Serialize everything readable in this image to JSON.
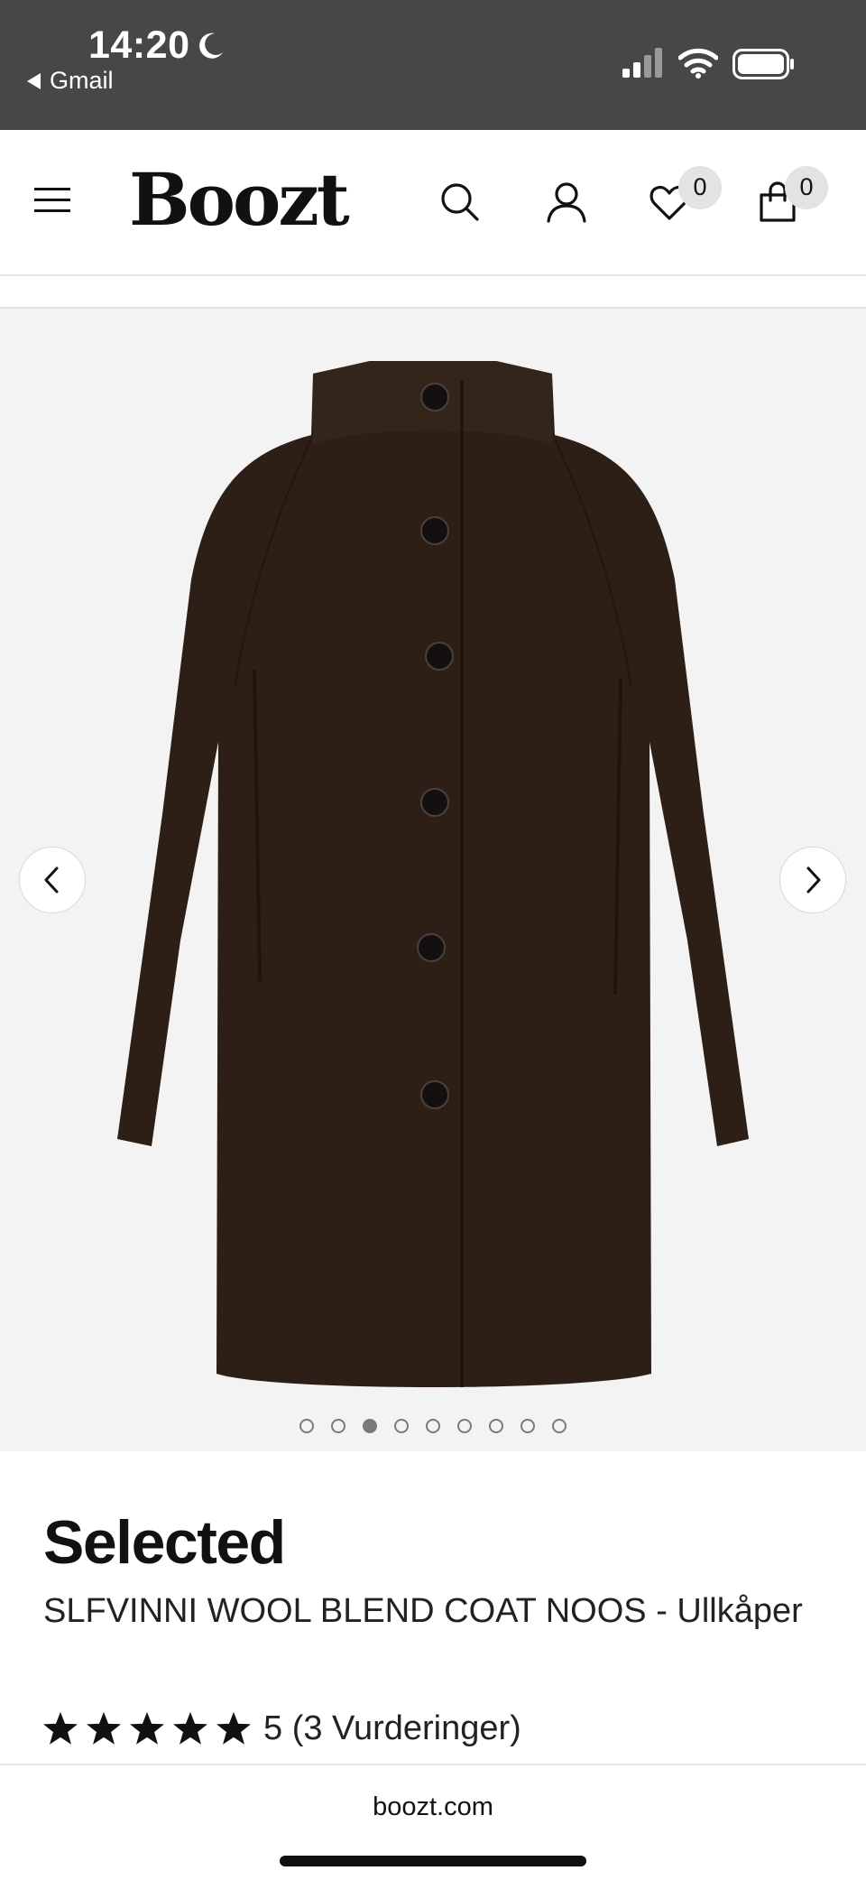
{
  "status_bar": {
    "time": "14:20",
    "back_app": "Gmail"
  },
  "header": {
    "logo": "Boozt",
    "wishlist_count": "0",
    "bag_count": "0"
  },
  "gallery": {
    "image_count": 9,
    "active_index": 2,
    "image_subject": "coat-image"
  },
  "product": {
    "brand": "Selected",
    "name": "SLFVINNI WOOL BLEND COAT NOOS - Ullkåper",
    "rating_value": 5,
    "rating_text": "5 (3 Vurderinger)"
  },
  "browser": {
    "url": "boozt.com"
  },
  "colors": {
    "status_bar_bg": "#474747",
    "gallery_bg": "#f3f3f3",
    "coat_color": "#2e1f16",
    "badge_bg": "#e3e3e3"
  }
}
